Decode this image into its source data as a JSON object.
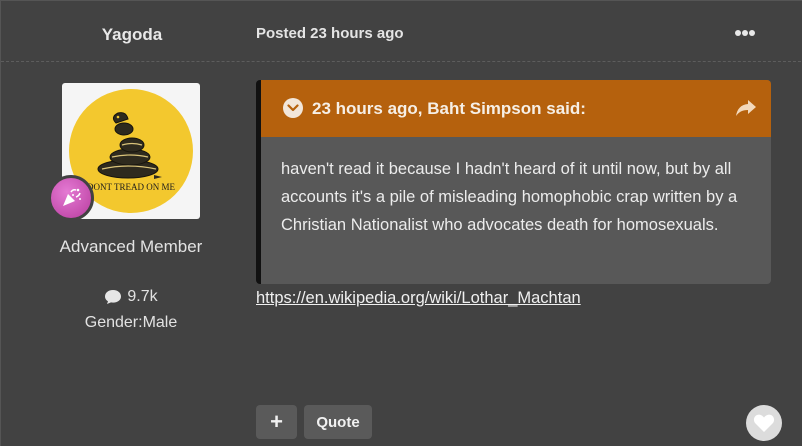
{
  "post": {
    "author": "Yagoda",
    "posted": "Posted 23 hours ago",
    "rank": "Advanced Member",
    "post_count": "9.7k",
    "gender": "Gender:Male",
    "avatar_caption": "DONT TREAD ON ME",
    "quote": {
      "citation": "23 hours ago, Baht Simpson said:",
      "text": "haven't read it because I hadn't heard of it until now, but by all accounts it's a pile of misleading homophobic crap written by a Christian Nationalist who advocates death for homosexuals."
    },
    "link": "https://en.wikipedia.org/wiki/Lothar_Machtan",
    "actions": {
      "plus_label": "+",
      "quote_label": "Quote"
    }
  },
  "icons": {
    "more": "ellipsis-icon",
    "toggle": "chevron-down-icon",
    "share": "share-arrow-icon",
    "comments": "speech-bubble-icon",
    "badge": "party-popper-icon",
    "react": "heart-icon"
  },
  "colors": {
    "background": "#424242",
    "quote_header": "#b5610d",
    "quote_body": "#585858",
    "avatar_yellow": "#f3c82e",
    "badge_pink": "#c94aae"
  }
}
